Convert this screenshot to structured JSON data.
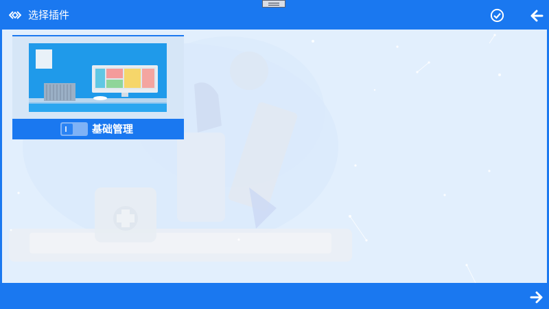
{
  "header": {
    "title": "选择插件",
    "title_icon": "plugin-code-icon",
    "confirm_icon": "check-circle-icon",
    "back_icon": "arrow-left-icon"
  },
  "plugins": [
    {
      "name": "基础管理",
      "enabled": true,
      "thumbnail": "computer-monitor-illustration"
    }
  ],
  "footer": {
    "next_icon": "arrow-right-icon"
  },
  "colors": {
    "accent": "#1a78f0",
    "content_bg": "#e2effd",
    "card_bg": "#d6e6f7"
  }
}
